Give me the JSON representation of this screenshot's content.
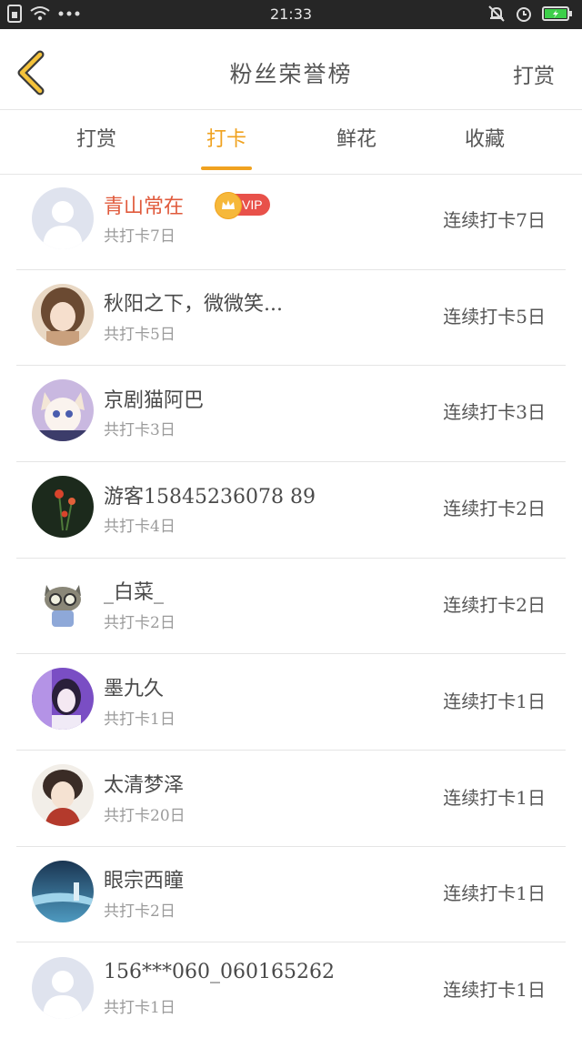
{
  "status_bar": {
    "time": "21:33"
  },
  "nav": {
    "title": "粉丝荣誉榜",
    "right_action": "打赏"
  },
  "tabs": [
    {
      "label": "打赏",
      "active": false
    },
    {
      "label": "打卡",
      "active": true
    },
    {
      "label": "鲜花",
      "active": false
    },
    {
      "label": "收藏",
      "active": false
    }
  ],
  "colors": {
    "accent": "#f0a21f",
    "vip_name": "#e05a3c",
    "vip_badge": "#e8514a"
  },
  "list": [
    {
      "name": "青山常在",
      "vip": true,
      "vip_label": "VIP",
      "total": "共打卡7日",
      "streak": "连续打卡7日",
      "avatar": "default-avatar"
    },
    {
      "name": "秋阳之下，微微笑...",
      "vip": false,
      "total": "共打卡5日",
      "streak": "连续打卡5日",
      "avatar": "anime-girl-avatar"
    },
    {
      "name": "京剧猫阿巴",
      "vip": false,
      "total": "共打卡3日",
      "streak": "连续打卡3日",
      "avatar": "anime-cat-avatar"
    },
    {
      "name": "游客15845236078 89",
      "vip": false,
      "total": "共打卡4日",
      "streak": "连续打卡2日",
      "avatar": "flowers-avatar"
    },
    {
      "name": "_白菜_",
      "vip": false,
      "total": "共打卡2日",
      "streak": "连续打卡2日",
      "avatar": "cartoon-raccoon-avatar"
    },
    {
      "name": "墨九久",
      "vip": false,
      "total": "共打卡1日",
      "streak": "连续打卡1日",
      "avatar": "purple-girl-avatar"
    },
    {
      "name": "太清梦泽",
      "vip": false,
      "total": "共打卡20日",
      "streak": "连续打卡1日",
      "avatar": "anime-boy-avatar"
    },
    {
      "name": "眼宗西瞳",
      "vip": false,
      "total": "共打卡2日",
      "streak": "连续打卡1日",
      "avatar": "blue-scene-avatar"
    },
    {
      "name": "156***060_060165262",
      "vip": false,
      "total": "共打卡1日",
      "streak": "连续打卡1日",
      "avatar": "default-avatar"
    }
  ]
}
